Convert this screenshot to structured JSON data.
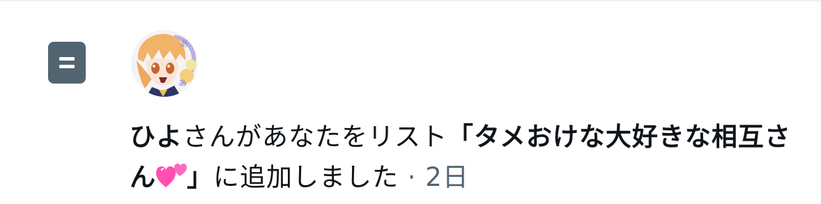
{
  "notification": {
    "icon": "list-icon",
    "avatar": "anime-character-avatar",
    "user_name": "ひよ",
    "text_part1": "さんがあなたをリスト",
    "list_open_quote": "「",
    "list_name": "タメおけな大好きな相互さん",
    "list_emoji": "💞",
    "list_close_quote": "」",
    "text_part2": "に追加しました",
    "separator": " · ",
    "time": "2日"
  },
  "colors": {
    "icon_bg": "#536471",
    "text": "#0f1419",
    "secondary": "#536471",
    "heart": "#ff4fb0"
  }
}
